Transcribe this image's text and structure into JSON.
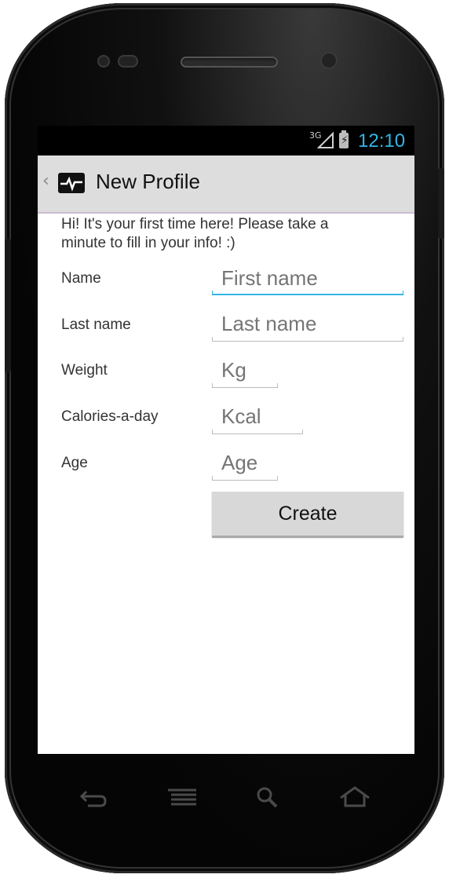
{
  "status_bar": {
    "network_label": "3G",
    "time": "12:10",
    "icons": [
      "signal-icon",
      "battery-charging-icon"
    ]
  },
  "action_bar": {
    "title": "New Profile",
    "icons": [
      "up-caret-icon",
      "heartbeat-app-icon"
    ]
  },
  "form": {
    "intro": "Hi! It's your first time here! Please take a minute to fill in your info! :)",
    "fields": [
      {
        "label": "Name",
        "placeholder": "First name",
        "value": ""
      },
      {
        "label": "Last name",
        "placeholder": "Last name",
        "value": ""
      },
      {
        "label": "Weight",
        "placeholder": "Kg",
        "value": ""
      },
      {
        "label": "Calories-a-day",
        "placeholder": "Kcal",
        "value": ""
      },
      {
        "label": "Age",
        "placeholder": "Age",
        "value": ""
      }
    ],
    "submit_label": "Create"
  },
  "nav_bar": {
    "icons": [
      "back-icon",
      "menu-icon",
      "search-icon",
      "home-icon"
    ]
  },
  "colors": {
    "accent": "#33b5e5",
    "action_bar_bg": "#dddddd",
    "button_bg": "#d8d8d8"
  }
}
